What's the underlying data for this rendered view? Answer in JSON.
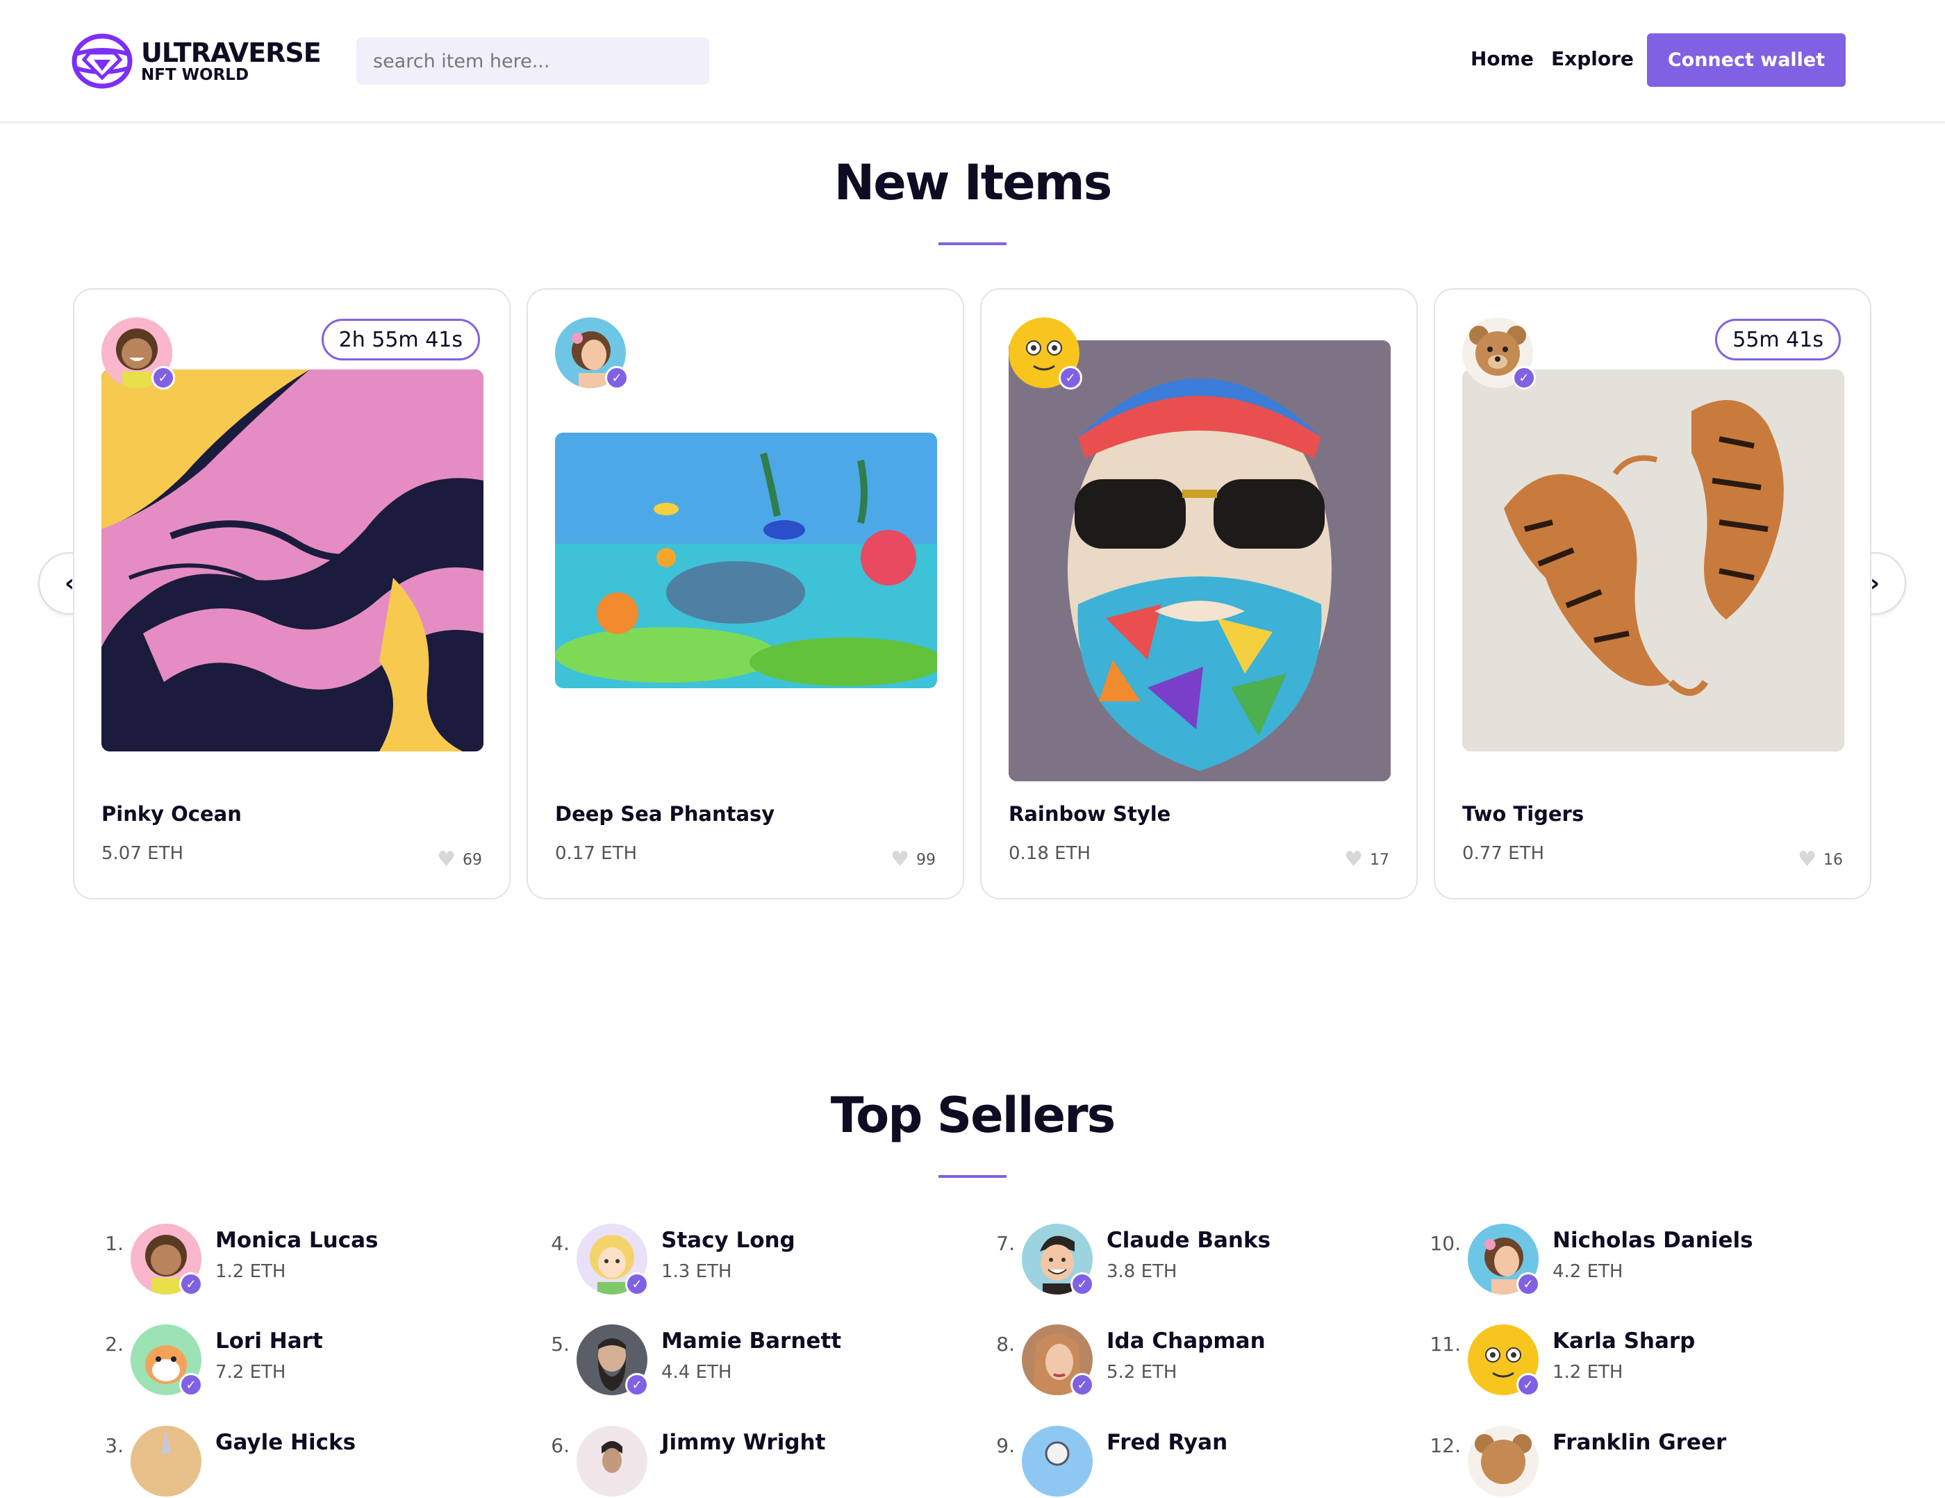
{
  "brand": {
    "title": "ULTRAVERSE",
    "subtitle": "NFT WORLD"
  },
  "search": {
    "placeholder": "search item here..."
  },
  "nav": {
    "home": "Home",
    "explore": "Explore",
    "connect": "Connect wallet"
  },
  "new_items": {
    "title": "New Items",
    "cards": [
      {
        "name": "Pinky Ocean",
        "price": "5.07 ETH",
        "likes": "69",
        "timer": "2h 55m 41s"
      },
      {
        "name": "Deep Sea Phantasy",
        "price": "0.17 ETH",
        "likes": "99",
        "timer": ""
      },
      {
        "name": "Rainbow Style",
        "price": "0.18 ETH",
        "likes": "17",
        "timer": ""
      },
      {
        "name": "Two Tigers",
        "price": "0.77 ETH",
        "likes": "16",
        "timer": "55m 41s"
      }
    ],
    "prev_label": "‹",
    "next_label": "›"
  },
  "top_sellers": {
    "title": "Top Sellers",
    "sellers": [
      {
        "rank": "1.",
        "name": "Monica Lucas",
        "eth": "1.2 ETH"
      },
      {
        "rank": "2.",
        "name": "Lori Hart",
        "eth": "7.2 ETH"
      },
      {
        "rank": "3.",
        "name": "Gayle Hicks",
        "eth": ""
      },
      {
        "rank": "4.",
        "name": "Stacy Long",
        "eth": "1.3 ETH"
      },
      {
        "rank": "5.",
        "name": "Mamie Barnett",
        "eth": "4.4 ETH"
      },
      {
        "rank": "6.",
        "name": "Jimmy Wright",
        "eth": ""
      },
      {
        "rank": "7.",
        "name": "Claude Banks",
        "eth": "3.8 ETH"
      },
      {
        "rank": "8.",
        "name": "Ida Chapman",
        "eth": "5.2 ETH"
      },
      {
        "rank": "9.",
        "name": "Fred Ryan",
        "eth": ""
      },
      {
        "rank": "10.",
        "name": "Nicholas Daniels",
        "eth": "4.2 ETH"
      },
      {
        "rank": "11.",
        "name": "Karla Sharp",
        "eth": "1.2 ETH"
      },
      {
        "rank": "12.",
        "name": "Franklin Greer",
        "eth": ""
      }
    ]
  },
  "colors": {
    "accent": "#8061e3",
    "text": "#0d0c22",
    "search_bg": "#f1effa"
  },
  "icons": {
    "verified": "check-badge-icon",
    "like": "heart-icon"
  }
}
